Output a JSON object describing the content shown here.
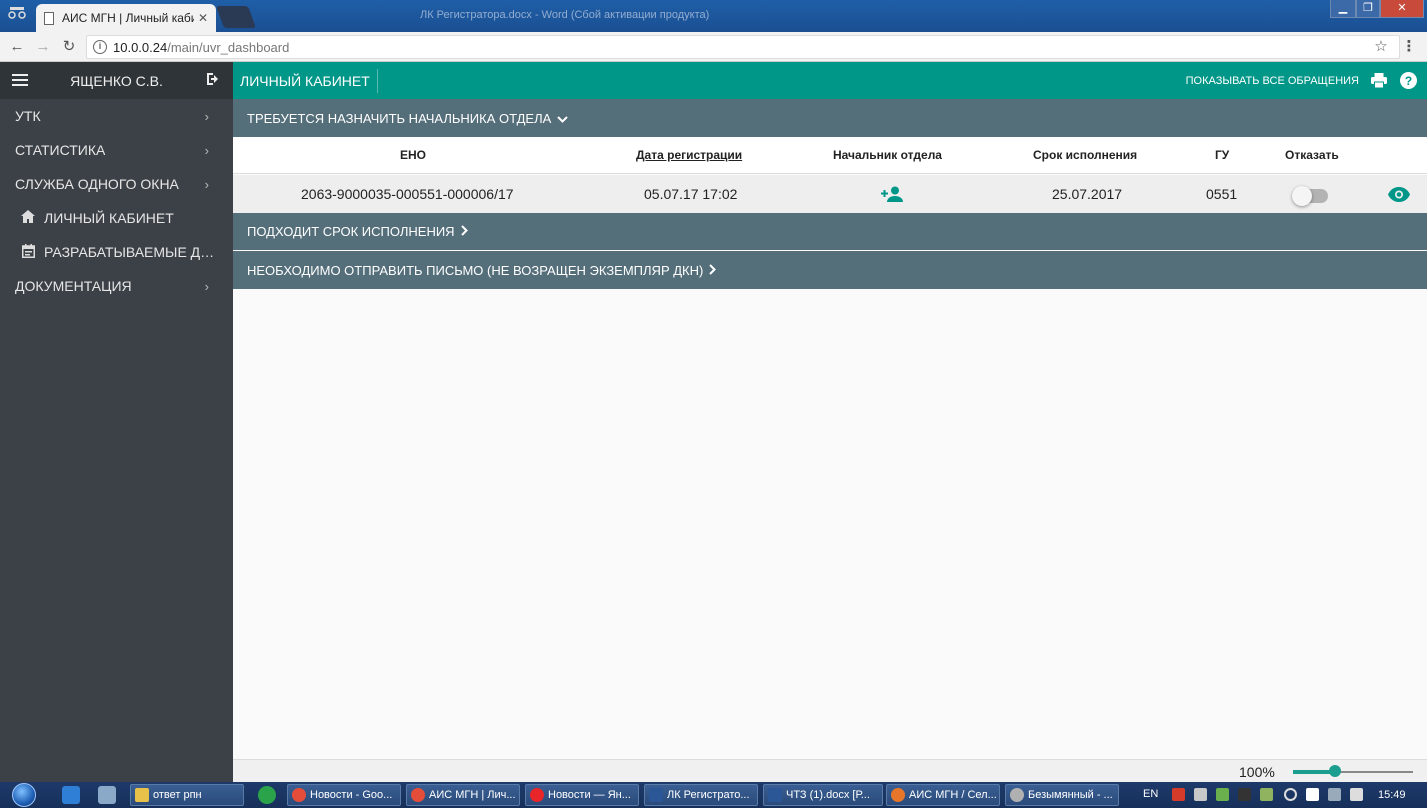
{
  "browser": {
    "tab_title": "АИС МГН | Личный каби",
    "background_window_title": "ЛК Регистратора.docx - Word (Сбой активации продукта)",
    "url_host": "10.0.0.24",
    "url_path": "/main/uvr_dashboard"
  },
  "sidebar": {
    "user_name": "ЯЩЕНКО С.В.",
    "items": [
      {
        "label": "УТК",
        "has_chevron": true,
        "icon": ""
      },
      {
        "label": "СТАТИСТИКА",
        "has_chevron": true,
        "icon": ""
      },
      {
        "label": "СЛУЖБА ОДНОГО ОКНА",
        "has_chevron": true,
        "icon": ""
      },
      {
        "label": "ЛИЧНЫЙ КАБИНЕТ",
        "has_chevron": false,
        "icon": "home-icon"
      },
      {
        "label": "РАЗРАБАТЫВАЕМЫЕ ДОКУМЕНТЫ",
        "has_chevron": false,
        "icon": "calendar-icon"
      },
      {
        "label": "ДОКУМЕНТАЦИЯ",
        "has_chevron": true,
        "icon": ""
      }
    ]
  },
  "topbar": {
    "title": "ЛИЧНЫЙ КАБИНЕТ",
    "show_all": "ПОКАЗЫВАТЬ ВСЕ ОБРАЩЕНИЯ"
  },
  "sections": {
    "assign_head": "ТРЕБУЕТСЯ НАЗНАЧИТЬ НАЧАЛЬНИКА ОТДЕЛА",
    "deadline": "ПОДХОДИТ СРОК ИСПОЛНЕНИЯ",
    "send_letter": "НЕОБХОДИМО ОТПРАВИТЬ ПИСЬМО (НЕ ВОЗРАЩЕН ЭКЗЕМПЛЯР ДКН)"
  },
  "table": {
    "headers": {
      "eno": "ЕНО",
      "reg_date": "Дата регистрации",
      "dept_head": "Начальник отдела",
      "due": "Срок исполнения",
      "gu": "ГУ",
      "refuse": "Отказать"
    },
    "row": {
      "eno": "2063-9000035-000551-000006/17",
      "reg_date": "05.07.17 17:02",
      "due": "25.07.2017",
      "gu": "0551",
      "refuse_on": false
    }
  },
  "zoom": {
    "label": "100%",
    "level_fraction": 0.35
  },
  "taskbar": {
    "buttons": [
      {
        "label": "ответ рпн",
        "color": "#e8c14a"
      },
      {
        "label": "Новости - Goo...",
        "color": "#e44d3a"
      },
      {
        "label": "АИС МГН | Лич...",
        "color": "#e44d3a"
      },
      {
        "label": "Новости — Ян...",
        "color": "#e8262a"
      },
      {
        "label": "ЛК Регистрато...",
        "color": "#2b5797"
      },
      {
        "label": "ЧТЗ (1).docx [Р...",
        "color": "#2b5797"
      },
      {
        "label": "АИС МГН / Сел...",
        "color": "#e8762a"
      },
      {
        "label": "Безымянный - ...",
        "color": "#b0b0b0"
      }
    ],
    "lang": "EN",
    "clock": "15:49"
  },
  "colors": {
    "teal": "#009688",
    "sidebar": "#3c4147",
    "section": "#546e7a"
  }
}
